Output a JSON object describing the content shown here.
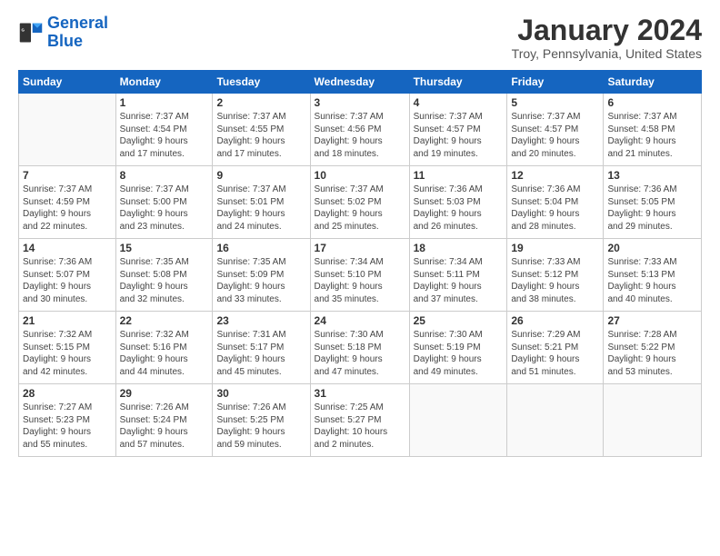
{
  "logo": {
    "line1": "General",
    "line2": "Blue"
  },
  "title": "January 2024",
  "subtitle": "Troy, Pennsylvania, United States",
  "days_header": [
    "Sunday",
    "Monday",
    "Tuesday",
    "Wednesday",
    "Thursday",
    "Friday",
    "Saturday"
  ],
  "weeks": [
    [
      {
        "day": "",
        "info": ""
      },
      {
        "day": "1",
        "info": "Sunrise: 7:37 AM\nSunset: 4:54 PM\nDaylight: 9 hours\nand 17 minutes."
      },
      {
        "day": "2",
        "info": "Sunrise: 7:37 AM\nSunset: 4:55 PM\nDaylight: 9 hours\nand 17 minutes."
      },
      {
        "day": "3",
        "info": "Sunrise: 7:37 AM\nSunset: 4:56 PM\nDaylight: 9 hours\nand 18 minutes."
      },
      {
        "day": "4",
        "info": "Sunrise: 7:37 AM\nSunset: 4:57 PM\nDaylight: 9 hours\nand 19 minutes."
      },
      {
        "day": "5",
        "info": "Sunrise: 7:37 AM\nSunset: 4:57 PM\nDaylight: 9 hours\nand 20 minutes."
      },
      {
        "day": "6",
        "info": "Sunrise: 7:37 AM\nSunset: 4:58 PM\nDaylight: 9 hours\nand 21 minutes."
      }
    ],
    [
      {
        "day": "7",
        "info": "Sunrise: 7:37 AM\nSunset: 4:59 PM\nDaylight: 9 hours\nand 22 minutes."
      },
      {
        "day": "8",
        "info": "Sunrise: 7:37 AM\nSunset: 5:00 PM\nDaylight: 9 hours\nand 23 minutes."
      },
      {
        "day": "9",
        "info": "Sunrise: 7:37 AM\nSunset: 5:01 PM\nDaylight: 9 hours\nand 24 minutes."
      },
      {
        "day": "10",
        "info": "Sunrise: 7:37 AM\nSunset: 5:02 PM\nDaylight: 9 hours\nand 25 minutes."
      },
      {
        "day": "11",
        "info": "Sunrise: 7:36 AM\nSunset: 5:03 PM\nDaylight: 9 hours\nand 26 minutes."
      },
      {
        "day": "12",
        "info": "Sunrise: 7:36 AM\nSunset: 5:04 PM\nDaylight: 9 hours\nand 28 minutes."
      },
      {
        "day": "13",
        "info": "Sunrise: 7:36 AM\nSunset: 5:05 PM\nDaylight: 9 hours\nand 29 minutes."
      }
    ],
    [
      {
        "day": "14",
        "info": "Sunrise: 7:36 AM\nSunset: 5:07 PM\nDaylight: 9 hours\nand 30 minutes."
      },
      {
        "day": "15",
        "info": "Sunrise: 7:35 AM\nSunset: 5:08 PM\nDaylight: 9 hours\nand 32 minutes."
      },
      {
        "day": "16",
        "info": "Sunrise: 7:35 AM\nSunset: 5:09 PM\nDaylight: 9 hours\nand 33 minutes."
      },
      {
        "day": "17",
        "info": "Sunrise: 7:34 AM\nSunset: 5:10 PM\nDaylight: 9 hours\nand 35 minutes."
      },
      {
        "day": "18",
        "info": "Sunrise: 7:34 AM\nSunset: 5:11 PM\nDaylight: 9 hours\nand 37 minutes."
      },
      {
        "day": "19",
        "info": "Sunrise: 7:33 AM\nSunset: 5:12 PM\nDaylight: 9 hours\nand 38 minutes."
      },
      {
        "day": "20",
        "info": "Sunrise: 7:33 AM\nSunset: 5:13 PM\nDaylight: 9 hours\nand 40 minutes."
      }
    ],
    [
      {
        "day": "21",
        "info": "Sunrise: 7:32 AM\nSunset: 5:15 PM\nDaylight: 9 hours\nand 42 minutes."
      },
      {
        "day": "22",
        "info": "Sunrise: 7:32 AM\nSunset: 5:16 PM\nDaylight: 9 hours\nand 44 minutes."
      },
      {
        "day": "23",
        "info": "Sunrise: 7:31 AM\nSunset: 5:17 PM\nDaylight: 9 hours\nand 45 minutes."
      },
      {
        "day": "24",
        "info": "Sunrise: 7:30 AM\nSunset: 5:18 PM\nDaylight: 9 hours\nand 47 minutes."
      },
      {
        "day": "25",
        "info": "Sunrise: 7:30 AM\nSunset: 5:19 PM\nDaylight: 9 hours\nand 49 minutes."
      },
      {
        "day": "26",
        "info": "Sunrise: 7:29 AM\nSunset: 5:21 PM\nDaylight: 9 hours\nand 51 minutes."
      },
      {
        "day": "27",
        "info": "Sunrise: 7:28 AM\nSunset: 5:22 PM\nDaylight: 9 hours\nand 53 minutes."
      }
    ],
    [
      {
        "day": "28",
        "info": "Sunrise: 7:27 AM\nSunset: 5:23 PM\nDaylight: 9 hours\nand 55 minutes."
      },
      {
        "day": "29",
        "info": "Sunrise: 7:26 AM\nSunset: 5:24 PM\nDaylight: 9 hours\nand 57 minutes."
      },
      {
        "day": "30",
        "info": "Sunrise: 7:26 AM\nSunset: 5:25 PM\nDaylight: 9 hours\nand 59 minutes."
      },
      {
        "day": "31",
        "info": "Sunrise: 7:25 AM\nSunset: 5:27 PM\nDaylight: 10 hours\nand 2 minutes."
      },
      {
        "day": "",
        "info": ""
      },
      {
        "day": "",
        "info": ""
      },
      {
        "day": "",
        "info": ""
      }
    ]
  ]
}
